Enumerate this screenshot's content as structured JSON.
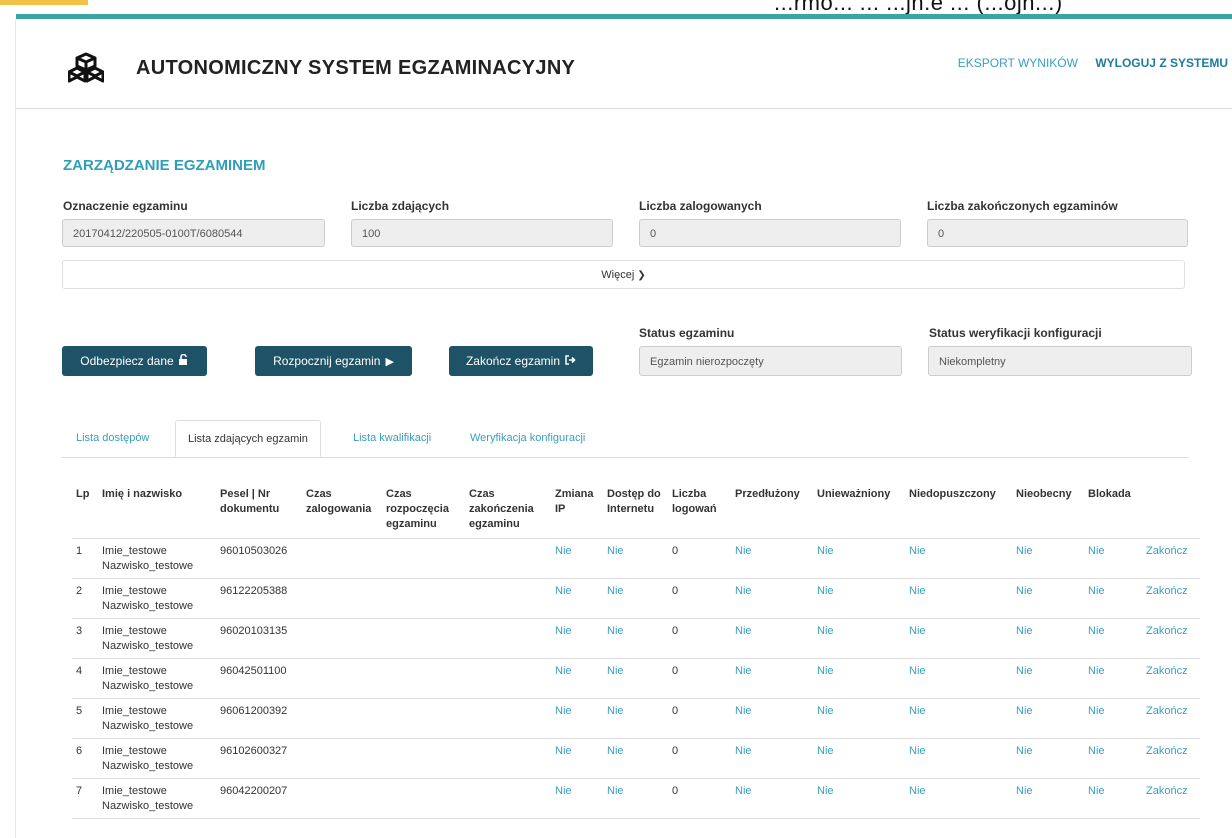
{
  "header": {
    "title": "AUTONOMICZNY SYSTEM EGZAMINACYJNY",
    "partial_top_text": "...rmo... ... ...jn.e ... (...ojn...)",
    "nav": {
      "export": "EKSPORT WYNIKÓW",
      "logout": "WYLOGUJ Z SYSTEMU"
    }
  },
  "section_title": "ZARZĄDZANIE EGZAMINEM",
  "fields": {
    "exam_id": {
      "label": "Oznaczenie egzaminu",
      "value": "20170412/220505-0100T/6080544"
    },
    "participants": {
      "label": "Liczba zdających",
      "value": "100"
    },
    "logged_in": {
      "label": "Liczba zalogowanych",
      "value": "0"
    },
    "finished": {
      "label": "Liczba zakończonych egzaminów",
      "value": "0"
    },
    "exam_status": {
      "label": "Status egzaminu",
      "value": "Egzamin nierozpoczęty"
    },
    "config_status": {
      "label": "Status weryfikacji konfiguracji",
      "value": "Niekompletny"
    }
  },
  "more_label": "Więcej",
  "buttons": {
    "unlock": "Odbezpiecz dane",
    "start": "Rozpocznij egzamin",
    "end": "Zakończ egzamin"
  },
  "tabs": [
    "Lista dostępów",
    "Lista zdających egzamin",
    "Lista kwalifikacji",
    "Weryfikacja konfiguracji"
  ],
  "table": {
    "headers": [
      "Lp",
      "Imię i nazwisko",
      "Pesel | Nr dokumentu",
      "Czas zalogowania",
      "Czas rozpoczęcia egzaminu",
      "Czas zakończenia egzaminu",
      "Zmiana IP",
      "Dostęp do Internetu",
      "Liczba logowań",
      "Przedłużony",
      "Unieważniony",
      "Niedopuszczony",
      "Nieobecny",
      "Blokada",
      ""
    ],
    "rows": [
      {
        "lp": "1",
        "first": "Imie_testowe",
        "last": "Nazwisko_testowe",
        "pesel": "96010503026",
        "login": "",
        "start": "",
        "end": "",
        "ip": "Nie",
        "internet": "Nie",
        "count": "0",
        "extended": "Nie",
        "invalid": "Nie",
        "notadmitted": "Nie",
        "absent": "Nie",
        "blocked": "Nie",
        "action": "Zakończ"
      },
      {
        "lp": "2",
        "first": "Imie_testowe",
        "last": "Nazwisko_testowe",
        "pesel": "96122205388",
        "login": "",
        "start": "",
        "end": "",
        "ip": "Nie",
        "internet": "Nie",
        "count": "0",
        "extended": "Nie",
        "invalid": "Nie",
        "notadmitted": "Nie",
        "absent": "Nie",
        "blocked": "Nie",
        "action": "Zakończ"
      },
      {
        "lp": "3",
        "first": "Imie_testowe",
        "last": "Nazwisko_testowe",
        "pesel": "96020103135",
        "login": "",
        "start": "",
        "end": "",
        "ip": "Nie",
        "internet": "Nie",
        "count": "0",
        "extended": "Nie",
        "invalid": "Nie",
        "notadmitted": "Nie",
        "absent": "Nie",
        "blocked": "Nie",
        "action": "Zakończ"
      },
      {
        "lp": "4",
        "first": "Imie_testowe",
        "last": "Nazwisko_testowe",
        "pesel": "96042501100",
        "login": "",
        "start": "",
        "end": "",
        "ip": "Nie",
        "internet": "Nie",
        "count": "0",
        "extended": "Nie",
        "invalid": "Nie",
        "notadmitted": "Nie",
        "absent": "Nie",
        "blocked": "Nie",
        "action": "Zakończ"
      },
      {
        "lp": "5",
        "first": "Imie_testowe",
        "last": "Nazwisko_testowe",
        "pesel": "96061200392",
        "login": "",
        "start": "",
        "end": "",
        "ip": "Nie",
        "internet": "Nie",
        "count": "0",
        "extended": "Nie",
        "invalid": "Nie",
        "notadmitted": "Nie",
        "absent": "Nie",
        "blocked": "Nie",
        "action": "Zakończ"
      },
      {
        "lp": "6",
        "first": "Imie_testowe",
        "last": "Nazwisko_testowe",
        "pesel": "96102600327",
        "login": "",
        "start": "",
        "end": "",
        "ip": "Nie",
        "internet": "Nie",
        "count": "0",
        "extended": "Nie",
        "invalid": "Nie",
        "notadmitted": "Nie",
        "absent": "Nie",
        "blocked": "Nie",
        "action": "Zakończ"
      },
      {
        "lp": "7",
        "first": "Imie_testowe",
        "last": "Nazwisko_testowe",
        "pesel": "96042200207",
        "login": "",
        "start": "",
        "end": "",
        "ip": "Nie",
        "internet": "Nie",
        "count": "0",
        "extended": "Nie",
        "invalid": "Nie",
        "notadmitted": "Nie",
        "absent": "Nie",
        "blocked": "Nie",
        "action": "Zakończ"
      }
    ]
  },
  "icons": {
    "logo": "cubes-icon",
    "more": "chevron-down-icon",
    "unlock": "unlock-icon",
    "start": "play-icon",
    "end": "sign-out-icon"
  },
  "colors": {
    "accent": "#3aa5a5",
    "link": "#3a9ebd",
    "button": "#1e5266",
    "title": "#2f9fb8",
    "top_yellow": "#f3c24a"
  }
}
